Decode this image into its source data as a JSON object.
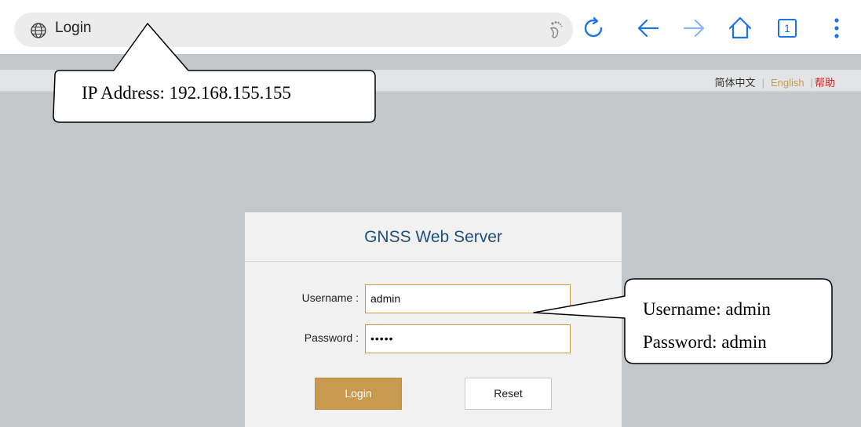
{
  "browser": {
    "tab_title": "Login",
    "tab_count": "1",
    "icons": {
      "globe": "globe-icon",
      "foot": "footprint-icon",
      "reload": "reload-icon",
      "back": "back-arrow-icon",
      "forward": "forward-arrow-icon",
      "home": "home-icon",
      "tabs": "tabs-icon",
      "menu": "more-vert-icon"
    },
    "accent_color": "#1a73e8"
  },
  "header": {
    "lang_cn": "简体中文",
    "separator": "|",
    "lang_en": "English",
    "help": "帮助"
  },
  "login": {
    "title": "GNSS Web Server",
    "username_label": "Username :",
    "username_value": "admin",
    "password_label": "Password :",
    "password_value": "•••••",
    "login_button": "Login",
    "reset_button": "Reset",
    "accent_color": "#c89a4e"
  },
  "callouts": {
    "ip": "IP Address: 192.168.155.155",
    "username": "Username: admin",
    "password": "Password: admin"
  }
}
